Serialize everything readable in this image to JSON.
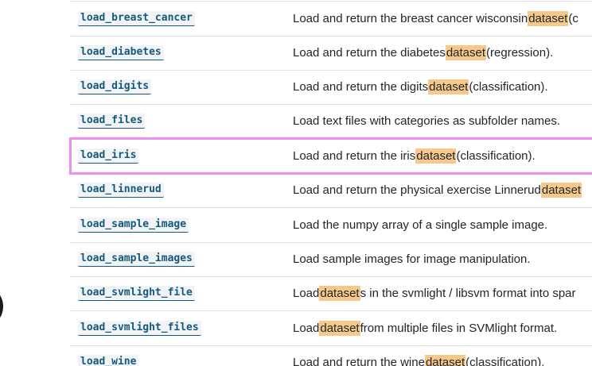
{
  "rows": [
    {
      "func": "load_breast_cancer",
      "pre": "Load and return the breast cancer wisconsin ",
      "hl": "dataset",
      "post": " (c"
    },
    {
      "func": "load_diabetes",
      "pre": "Load and return the diabetes ",
      "hl": "dataset",
      "post": " (regression)."
    },
    {
      "func": "load_digits",
      "pre": "Load and return the digits ",
      "hl": "dataset",
      "post": " (classification)."
    },
    {
      "func": "load_files",
      "pre": "Load text files with categories as subfolder names.",
      "hl": "",
      "post": ""
    },
    {
      "func": "load_iris",
      "pre": "Load and return the iris ",
      "hl": "dataset",
      "post": " (classification)."
    },
    {
      "func": "load_linnerud",
      "pre": "Load and return the physical exercise Linnerud ",
      "hl": "dataset",
      "post": ""
    },
    {
      "func": "load_sample_image",
      "pre": "Load the numpy array of a single sample image.",
      "hl": "",
      "post": ""
    },
    {
      "func": "load_sample_images",
      "pre": "Load sample images for image manipulation.",
      "hl": "",
      "post": ""
    },
    {
      "func": "load_svmlight_file",
      "pre": "Load ",
      "hl": "dataset",
      "post": "s in the svmlight / libsvm format into spar"
    },
    {
      "func": "load_svmlight_files",
      "pre": "Load ",
      "hl": "dataset",
      "post": " from multiple files in SVMlight format."
    },
    {
      "func": "load_wine",
      "pre": "Load and return the wine ",
      "hl": "dataset",
      "post": " (classification)."
    }
  ],
  "colors": {
    "link": "#125a7e",
    "highlight": "#f6c98a",
    "selection_border": "#ee8ef0"
  }
}
